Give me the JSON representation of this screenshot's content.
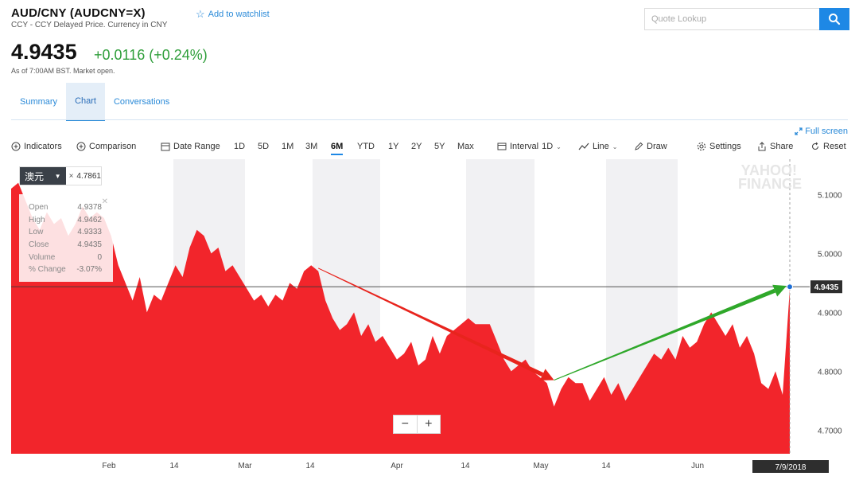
{
  "header": {
    "title": "AUD/CNY (AUDCNY=X)",
    "subtitle": "CCY - CCY Delayed Price. Currency in CNY",
    "watchlist_label": "Add to watchlist"
  },
  "search": {
    "placeholder": "Quote Lookup"
  },
  "quote": {
    "price": "4.9435",
    "change": "+0.0116 (+0.24%)",
    "as_of": "As of 7:00AM BST. Market open.",
    "change_color": "#2e9e3a"
  },
  "tabs": [
    {
      "label": "Summary",
      "active": false
    },
    {
      "label": "Chart",
      "active": true
    },
    {
      "label": "Conversations",
      "active": false
    }
  ],
  "toolbar": {
    "fullscreen": "Full screen",
    "indicators": "Indicators",
    "comparison": "Comparison",
    "date_range": "Date Range",
    "ranges": [
      "1D",
      "5D",
      "1M",
      "3M",
      "6M",
      "YTD",
      "1Y",
      "2Y",
      "5Y",
      "Max"
    ],
    "active_range": "6M",
    "interval_label": "Interval",
    "interval_value": "1D",
    "line_label": "Line",
    "draw_label": "Draw",
    "settings": "Settings",
    "share": "Share",
    "reset": "Reset"
  },
  "series_chip": {
    "label": "澳元",
    "value": "4.7861"
  },
  "ohlc_panel": {
    "rows": [
      {
        "label": "Open",
        "value": "4.9378"
      },
      {
        "label": "High",
        "value": "4.9462"
      },
      {
        "label": "Low",
        "value": "4.9333"
      },
      {
        "label": "Close",
        "value": "4.9435"
      },
      {
        "label": "Volume",
        "value": "0"
      },
      {
        "label": "% Change",
        "value": "-3.07%"
      }
    ]
  },
  "watermark": {
    "line1": "YAHOO!",
    "line2": "FINANCE"
  },
  "chart_data": {
    "type": "area",
    "title": "",
    "xlabel": "",
    "ylabel": "",
    "ylim": [
      4.66,
      5.16
    ],
    "yticks": [
      4.7,
      4.8,
      4.9,
      5.0,
      5.1
    ],
    "ytick_labels": [
      "4.7000",
      "4.8000",
      "4.9000",
      "5.0000",
      "5.1000"
    ],
    "x_tick_labels": [
      "Feb",
      "14",
      "Mar",
      "14",
      "Apr",
      "14",
      "May",
      "14",
      "Jun"
    ],
    "current_value": 4.9435,
    "current_label": "4.9435",
    "current_date": "7/9/2018",
    "fill_color": "#f2252b",
    "series": [
      {
        "values": [
          5.11,
          5.12,
          5.09,
          5.06,
          5.04,
          5.07,
          5.05,
          5.06,
          5.03,
          5.05,
          5.08,
          5.06,
          5.07,
          5.06,
          5.03,
          4.98,
          4.95,
          4.92,
          4.96,
          4.9,
          4.93,
          4.92,
          4.95,
          4.98,
          4.96,
          5.01,
          5.04,
          5.03,
          5.0,
          5.01,
          4.97,
          4.98,
          4.96,
          4.94,
          4.92,
          4.93,
          4.91,
          4.93,
          4.92,
          4.95,
          4.94,
          4.97,
          4.98,
          4.97,
          4.92,
          4.89,
          4.87,
          4.88,
          4.9,
          4.86,
          4.88,
          4.85,
          4.86,
          4.84,
          4.82,
          4.83,
          4.85,
          4.81,
          4.82,
          4.86,
          4.83,
          4.86,
          4.87,
          4.88,
          4.89,
          4.88,
          4.88,
          4.88,
          4.85,
          4.82,
          4.8,
          4.81,
          4.82,
          4.8,
          4.79,
          4.78,
          4.74,
          4.77,
          4.79,
          4.78,
          4.78,
          4.75,
          4.77,
          4.79,
          4.76,
          4.78,
          4.75,
          4.77,
          4.79,
          4.81,
          4.83,
          4.82,
          4.84,
          4.82,
          4.86,
          4.84,
          4.85,
          4.88,
          4.9,
          4.88,
          4.86,
          4.88,
          4.84,
          4.86,
          4.83,
          4.78,
          4.77,
          4.8,
          4.76,
          4.94
        ]
      }
    ],
    "annotations": [
      {
        "type": "arrow",
        "color": "#e8241d",
        "from": {
          "x_index": 43,
          "y": 4.975
        },
        "to": {
          "x_index": 76,
          "y": 4.785
        }
      },
      {
        "type": "arrow",
        "color": "#2fa82a",
        "from": {
          "x_index": 76,
          "y": 4.785
        },
        "to": {
          "x_index": 109,
          "y": 4.945
        }
      }
    ]
  }
}
